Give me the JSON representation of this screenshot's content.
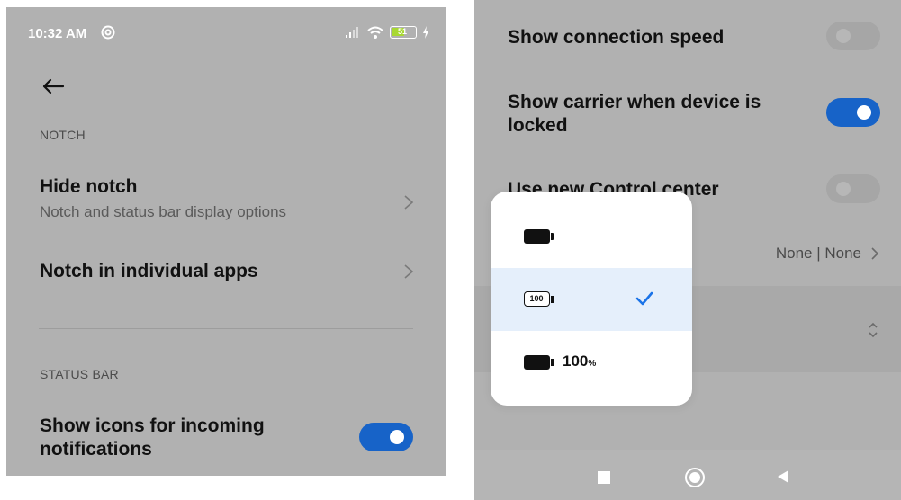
{
  "left_screen": {
    "status_bar": {
      "time": "10:32 AM",
      "battery_level": "51"
    },
    "back_icon": "arrow-left-icon",
    "section_notch": "NOTCH",
    "hide_notch": {
      "title": "Hide notch",
      "subtitle": "Notch and status bar display options"
    },
    "notch_apps": {
      "title": "Notch in individual apps"
    },
    "section_status_bar": "STATUS BAR",
    "incoming_icons": {
      "title_line1": "Show icons for incoming",
      "title_line2": "notifications",
      "enabled": true
    }
  },
  "right_screen": {
    "connection_speed": {
      "title": "Show connection speed",
      "enabled": false
    },
    "carrier_locked": {
      "title_line1": "Show carrier when device is",
      "title_line2": "locked",
      "enabled": true
    },
    "control_center": {
      "title": "Use new Control center",
      "enabled": false
    },
    "carrier_value": "None | None",
    "battery_popup": {
      "options": [
        {
          "style": "battery-icon-only",
          "label": ""
        },
        {
          "style": "battery-number-inside",
          "inner_text": "100",
          "selected": true
        },
        {
          "style": "battery-with-percentage",
          "label": "100",
          "unit": "%"
        }
      ]
    },
    "nav_icons": [
      "square-icon",
      "circle-home-icon",
      "triangle-back-icon"
    ]
  },
  "colors": {
    "accent": "#1763c8",
    "panel_bg": "#b1b1b1",
    "popup_selected": "#e5effb",
    "check": "#1a73e8"
  }
}
